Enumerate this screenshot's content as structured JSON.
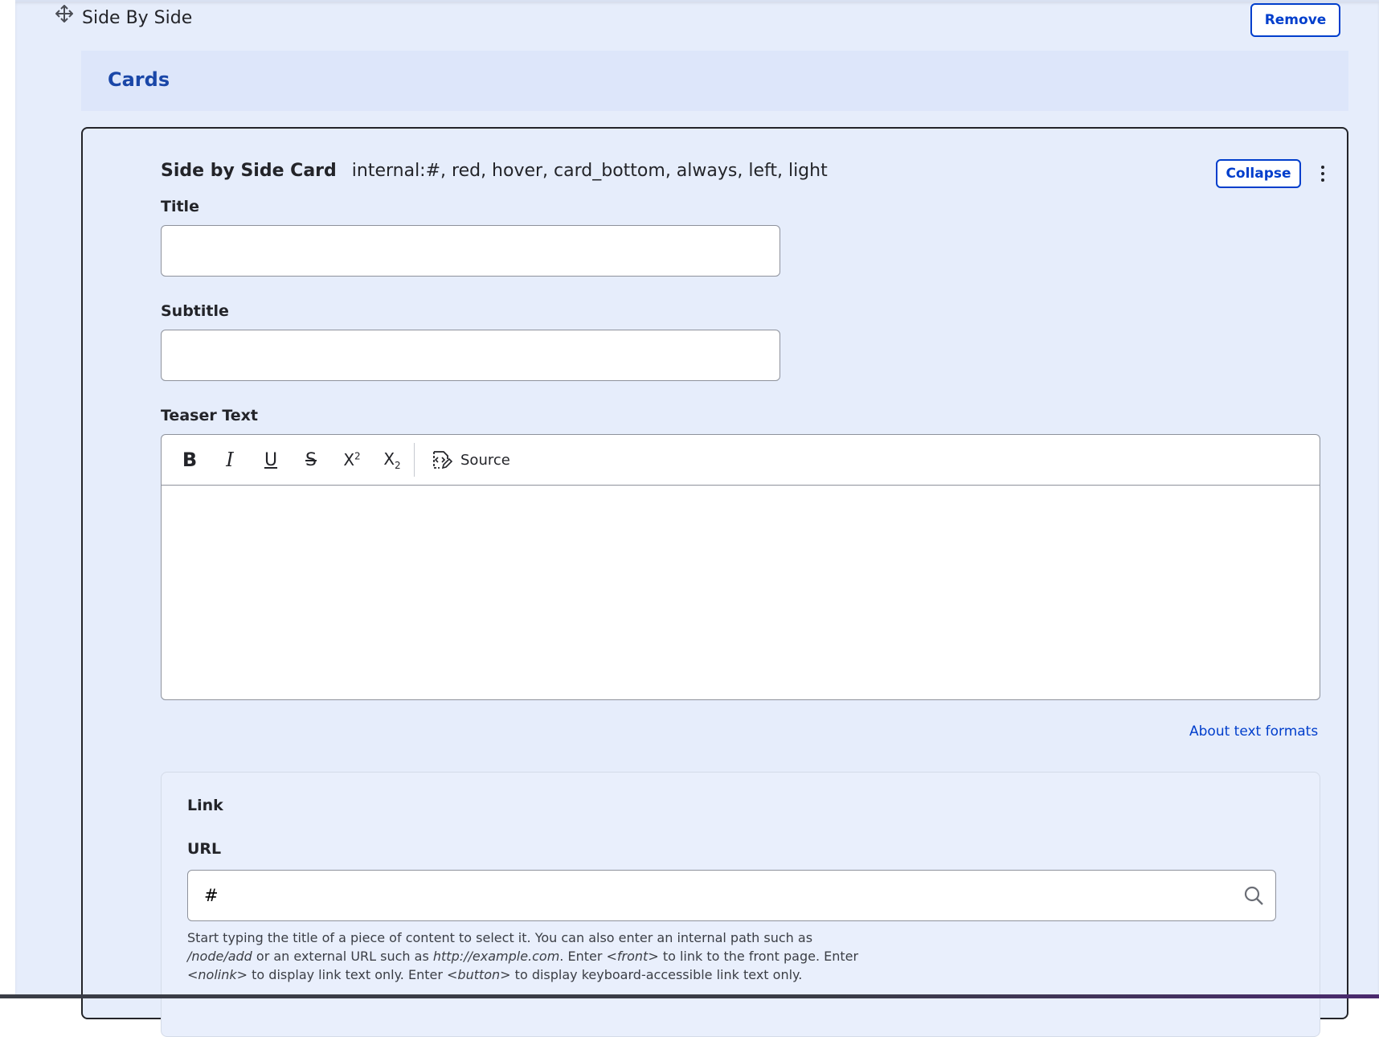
{
  "paragraph": {
    "title": "Side By Side",
    "remove_label": "Remove"
  },
  "cards_section": {
    "label": "Cards"
  },
  "card": {
    "type_name": "Side by Side Card",
    "summary": "internal:#, red, hover, card_bottom, always, left, light",
    "collapse_label": "Collapse",
    "fields": {
      "title_label": "Title",
      "title_value": "",
      "subtitle_label": "Subtitle",
      "subtitle_value": "",
      "teaser_label": "Teaser Text"
    },
    "toolbar": {
      "bold": "B",
      "italic": "I",
      "underline": "U",
      "strike": "S",
      "superscript": "X",
      "superscript_mark": "2",
      "subscript": "X",
      "subscript_mark": "2",
      "source_label": "Source"
    },
    "about_text_formats": "About text formats",
    "link": {
      "section_title": "Link",
      "url_label": "URL",
      "url_value": "#",
      "help": {
        "p1": "Start typing the title of a piece of content to select it. You can also enter an internal path such as ",
        "e1": "/node/add",
        "p2": " or an external URL such as ",
        "e2": "http://example.com",
        "p3": ". Enter ",
        "e3": "<front>",
        "p4": " to link to the front page. Enter ",
        "e4": "<nolink>",
        "p5": " to display link text only. Enter ",
        "e5": "<button>",
        "p6": " to display keyboard-accessible link text only."
      }
    }
  },
  "colors": {
    "accent": "#003ecc",
    "panel_bg": "#e6edfb",
    "text": "#232429"
  }
}
